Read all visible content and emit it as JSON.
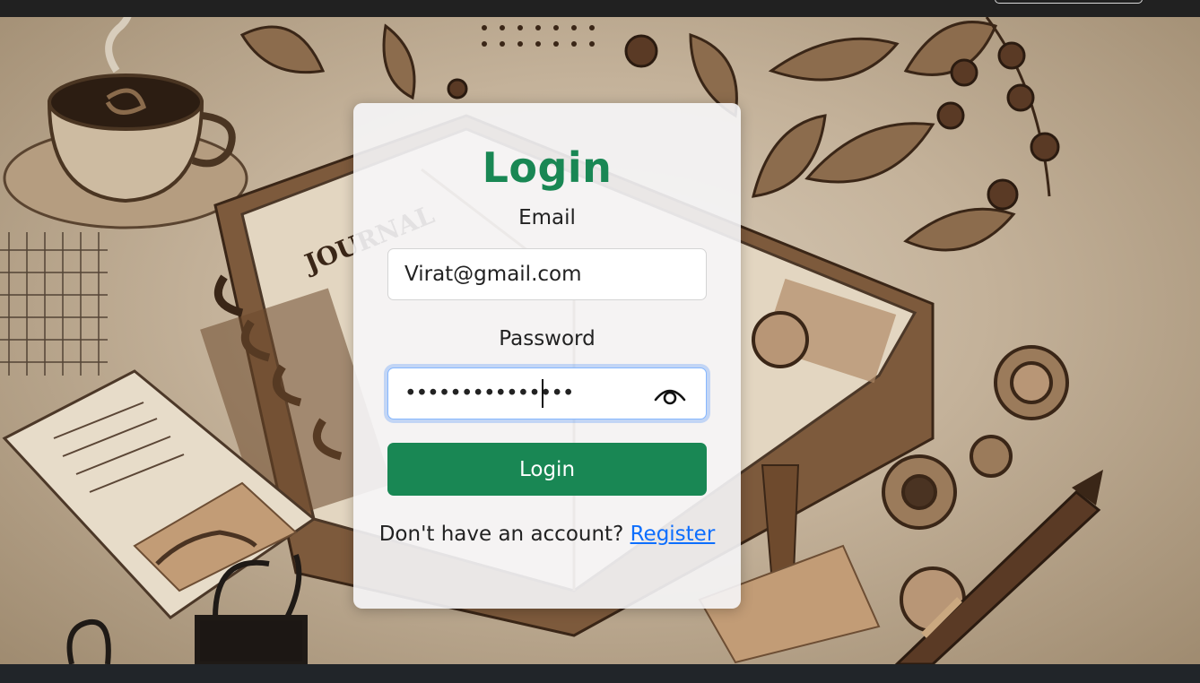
{
  "nav": {
    "right_button": ""
  },
  "form": {
    "title": "Login",
    "email_label": "Email",
    "email_value": "Virat@gmail.com",
    "password_label": "Password",
    "password_masked": "•••••••••••••••",
    "submit_label": "Login",
    "register_prompt": "Don't have an account?",
    "register_link": "Register"
  },
  "background": {
    "journal_text": "JOURNAL"
  },
  "icons": {
    "password_toggle": "eye-icon"
  },
  "colors": {
    "primary": "#198754",
    "link": "#0d6efd",
    "focus_ring": "#86b7fe",
    "topbar": "#212121",
    "footer": "#212529"
  }
}
